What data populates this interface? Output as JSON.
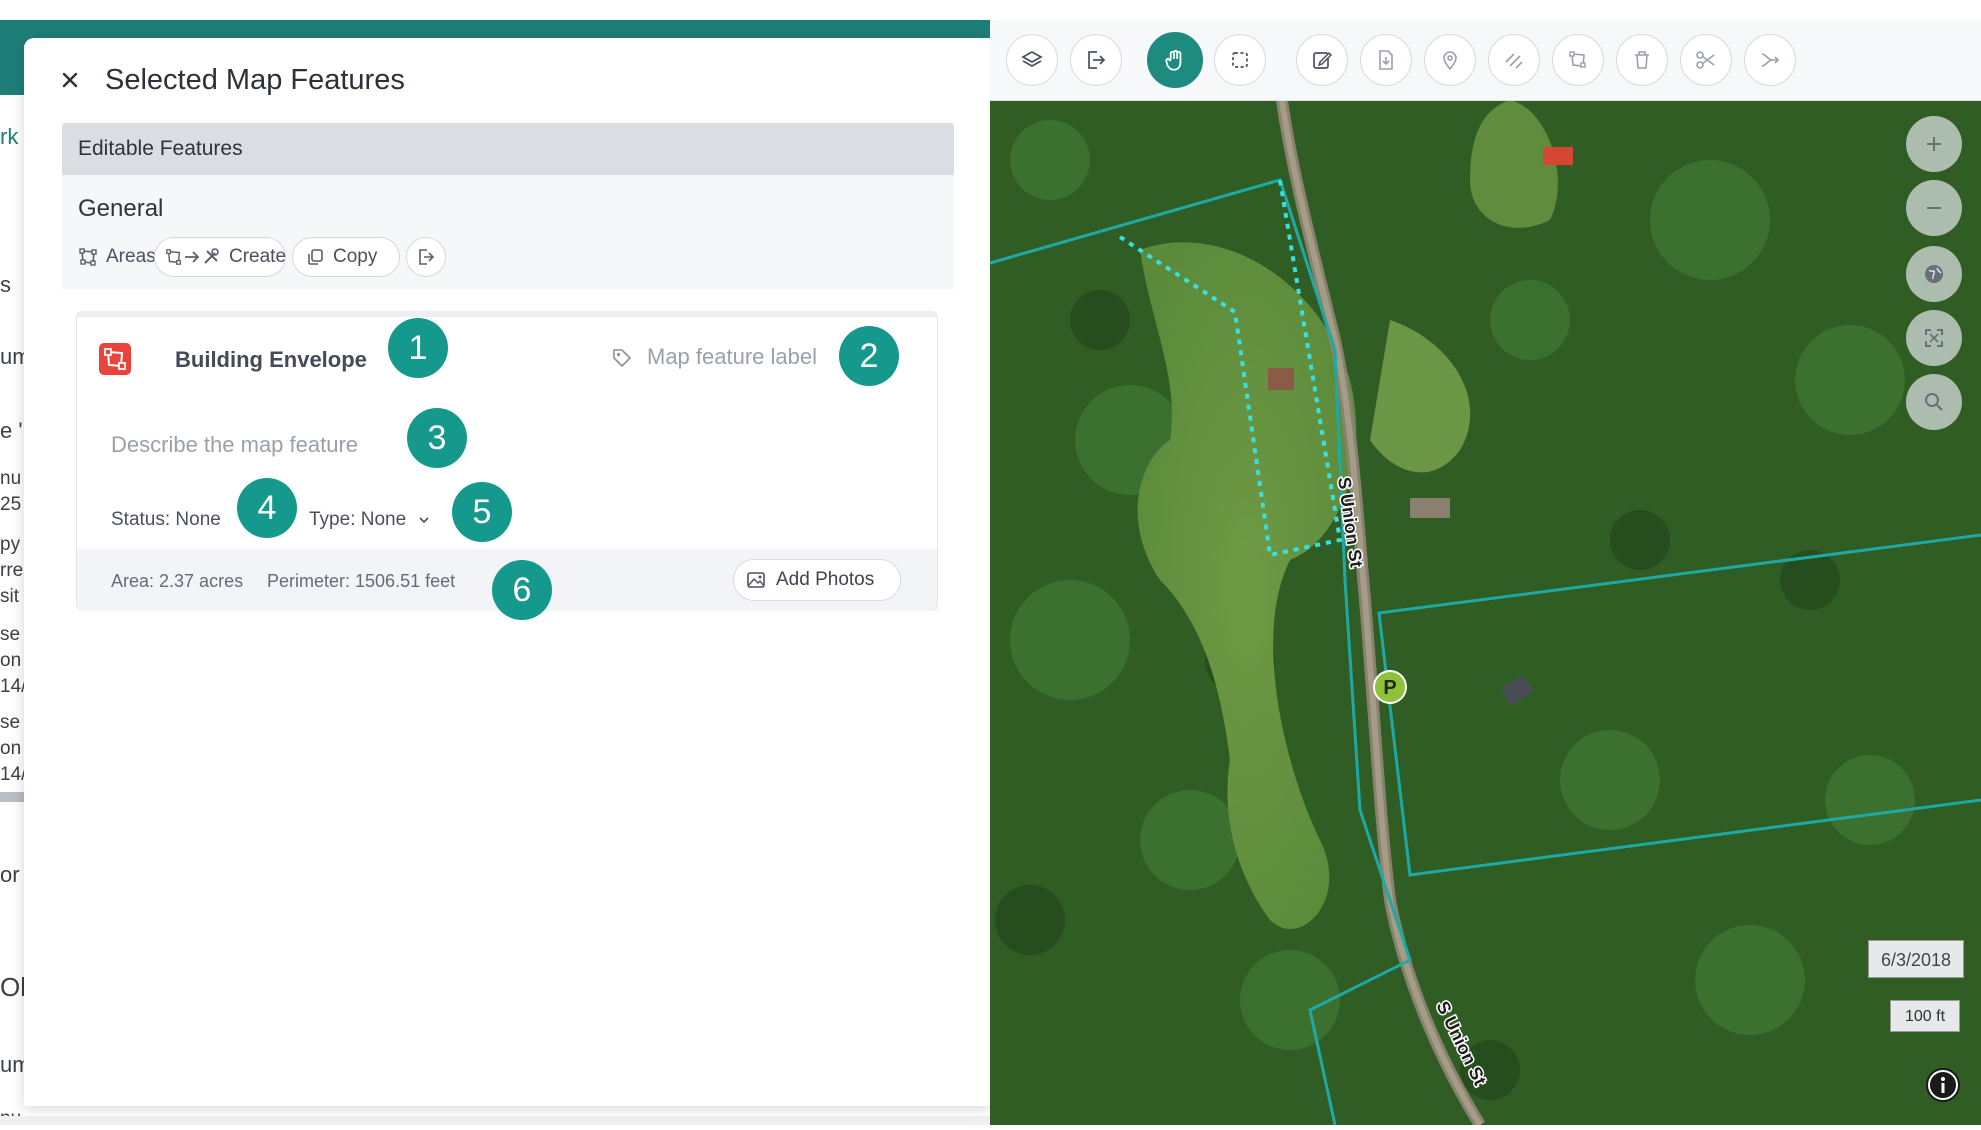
{
  "background": {
    "fragments": [
      "rk",
      "s",
      "um",
      "e '",
      "nu",
      "25",
      "py",
      "rre",
      "sit",
      "se",
      "on",
      "14/",
      "se",
      "on",
      "14/",
      "or",
      "Ob",
      "um",
      "nu"
    ]
  },
  "panel": {
    "title": "Selected Map Features",
    "close_label": "×",
    "section_header": "Editable Features",
    "general": {
      "title": "General",
      "areas_label": "Areas",
      "create_label": "Create",
      "copy_label": "Copy"
    }
  },
  "feature": {
    "name": "Building Envelope",
    "label_placeholder": "Map feature label",
    "description_placeholder": "Describe the map feature",
    "status": "Status: None",
    "type": "Type: None",
    "area": "Area: 2.37 acres",
    "perimeter": "Perimeter: 1506.51 feet",
    "add_photos_label": "Add Photos",
    "icon_color": "#e8443b"
  },
  "callouts": [
    "1",
    "2",
    "3",
    "4",
    "5",
    "6"
  ],
  "map": {
    "road_labels": [
      "S Union St",
      "S Union St"
    ],
    "parking_label": "P",
    "date": "6/3/2018",
    "scale": "100 ft",
    "boundary_color": "#1fa9a5",
    "envelope_color": "#38e0e0"
  },
  "toolbar": {
    "tools": [
      "layers-icon",
      "export-icon",
      "pan-hand-icon",
      "select-box-icon",
      "edit-icon",
      "import-icon",
      "pin-icon",
      "draw-line-icon",
      "polygon-icon",
      "trash-icon",
      "scissors-icon",
      "merge-icon"
    ],
    "active_tool": "pan-hand-icon"
  },
  "colors": {
    "accent": "#1d8b80",
    "callout": "#15998c"
  }
}
